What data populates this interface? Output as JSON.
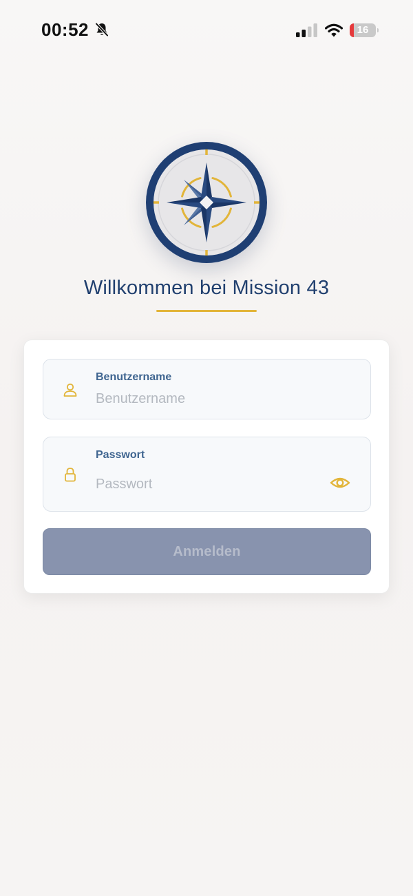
{
  "status_bar": {
    "time": "00:52",
    "battery_level": "16",
    "battery_fraction": 0.16,
    "icons": [
      "bell-slash-icon",
      "signal-icon",
      "wifi-icon",
      "battery-icon"
    ]
  },
  "logo": {
    "icon": "compass-rose-logo",
    "colors": {
      "navy": "#1f3f73",
      "gold": "#e2b53a",
      "light": "#e6e6e8"
    }
  },
  "welcome": {
    "title": "Willkommen bei Mission 43"
  },
  "form": {
    "username": {
      "label": "Benutzername",
      "placeholder": "Benutzername",
      "value": "",
      "icon": "user-icon"
    },
    "password": {
      "label": "Passwort",
      "placeholder": "Passwort",
      "value": "",
      "icon": "lock-icon",
      "toggle_icon": "eye-icon"
    },
    "submit_label": "Anmelden"
  },
  "colors": {
    "accent": "#e2b53a",
    "primary": "#21406f",
    "label": "#3f6590",
    "button_disabled": "#8893ae"
  }
}
